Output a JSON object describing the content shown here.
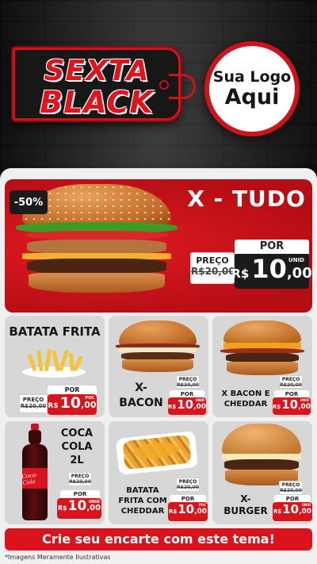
{
  "header": {
    "tag_line1": "SEXTA",
    "tag_line2": "BLACK",
    "logo_line1": "Sua Logo",
    "logo_line2": "Aqui"
  },
  "featured": {
    "discount": "-50%",
    "title": "X - TUDO",
    "old_label": "PREÇO",
    "old_price": "R$20,00",
    "por_label": "POR",
    "currency": "R$",
    "price_int": "10",
    "price_dec": ",00",
    "unit": "UNID"
  },
  "products": [
    {
      "name": "BATATA FRITA",
      "old_label": "PREÇO",
      "old_price": "R$20,00",
      "por_label": "POR",
      "currency": "R$",
      "price_int": "10",
      "price_dec": ",00",
      "unit": "POC"
    },
    {
      "name_l1": "X-",
      "name_l2": "BACON",
      "old_label": "PREÇO",
      "old_price": "R$20,00",
      "por_label": "POR",
      "currency": "R$",
      "price_int": "10",
      "price_dec": ",00",
      "unit": "UNID"
    },
    {
      "name_l1": "X BACON E",
      "name_l2": "CHEDDAR",
      "old_label": "PREÇO",
      "old_price": "R$20,00",
      "por_label": "POR",
      "currency": "R$",
      "price_int": "10",
      "price_dec": ",00",
      "unit": "UNID"
    },
    {
      "name_l1": "COCA",
      "name_l2": "COLA",
      "name_l3": "2L",
      "old_label": "PREÇO",
      "old_price": "R$20,00",
      "por_label": "POR",
      "currency": "R$",
      "price_int": "10",
      "price_dec": ",00",
      "unit": "UNID"
    },
    {
      "name_l1": "BATATA",
      "name_l2": "FRITA COM",
      "name_l3": "CHEDDAR",
      "old_label": "PREÇO",
      "old_price": "R$20,00",
      "por_label": "POR",
      "currency": "R$",
      "price_int": "10",
      "price_dec": ",00",
      "unit": "POC"
    },
    {
      "name_l1": "X-",
      "name_l2": "BURGER",
      "old_label": "PREÇO",
      "old_price": "R$20,00",
      "por_label": "POR",
      "currency": "R$",
      "price_int": "10",
      "price_dec": ",00",
      "unit": "UNID"
    }
  ],
  "coke_label": "Coca-Cola",
  "cta": "Crie seu encarte com este tema!",
  "footnote": "*Imagens Meramente Ilustrativas",
  "colors": {
    "accent": "#d9141c",
    "dark": "#1b1b1b",
    "panel": "#f0f0f0",
    "card": "#d7d7d7"
  }
}
